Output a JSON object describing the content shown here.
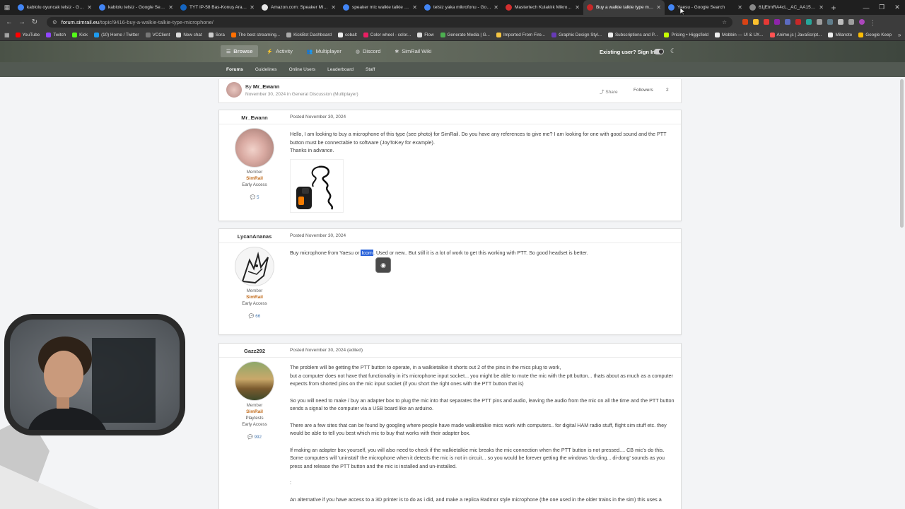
{
  "browser": {
    "tabs": [
      {
        "title": "kablolu oyuncak telsiz - Goog",
        "color": "#4285f4"
      },
      {
        "title": "kablolu telsiz - Google Search",
        "color": "#4285f4"
      },
      {
        "title": "TYT IP-58 Bas-Konuş Araç ve",
        "color": "#1565c0"
      },
      {
        "title": "Amazon.com: Speaker Mic W",
        "color": "#e6e6e6"
      },
      {
        "title": "speaker mic walkie talkie - Go",
        "color": "#4285f4"
      },
      {
        "title": "telsiz yaka mikrofonu - Googl",
        "color": "#4285f4"
      },
      {
        "title": "Mastertech Kulaklık Mikrofon",
        "color": "#d32f2f"
      },
      {
        "title": "Buy a walkie talkie type micro",
        "color": "#c62828"
      },
      {
        "title": "Yaesu - Google Search",
        "color": "#4285f4"
      },
      {
        "title": "61jEtmRA4cL._AC_AA152_.jpg",
        "color": "#888888"
      }
    ],
    "active_tab": 7,
    "new_tab": "+",
    "url_host": "forum.simrail.eu",
    "url_path": "/topic/9416-buy-a-walkie-talkie-type-microphone/",
    "bookmarks": [
      {
        "label": "YouTube",
        "color": "#ff0000"
      },
      {
        "label": "Twitch",
        "color": "#9146ff"
      },
      {
        "label": "Kick",
        "color": "#53fc18"
      },
      {
        "label": "(10) Home / Twitter",
        "color": "#1d9bf0"
      },
      {
        "label": "VCClient",
        "color": "#777777"
      },
      {
        "label": "New chat",
        "color": "#dddddd"
      },
      {
        "label": "Sora",
        "color": "#cccccc"
      },
      {
        "label": "The best streaming...",
        "color": "#ff6f00"
      },
      {
        "label": "KickBot Dashboard",
        "color": "#aaaaaa"
      },
      {
        "label": "cobalt",
        "color": "#eeeeee"
      },
      {
        "label": "Color wheel - color...",
        "color": "#e91e63"
      },
      {
        "label": "Flow",
        "color": "#dddddd"
      },
      {
        "label": "Generate Media | G...",
        "color": "#4caf50"
      },
      {
        "label": "Imported From Fire...",
        "color": "#f5c542"
      },
      {
        "label": "Graphic Design Styl...",
        "color": "#673ab7"
      },
      {
        "label": "Subscriptions and P...",
        "color": "#eeeeee"
      },
      {
        "label": "Pricing • Higgsfield",
        "color": "#c6ff00"
      },
      {
        "label": "Mobbin — UI & UX...",
        "color": "#eeeeee"
      },
      {
        "label": "Anime.js | JavaScript...",
        "color": "#ff5252"
      },
      {
        "label": "Milanote",
        "color": "#eeeeee"
      },
      {
        "label": "Google Keep",
        "color": "#fbbc04"
      }
    ]
  },
  "site": {
    "nav": [
      {
        "label": "Browse",
        "icon": "list-icon",
        "active": true
      },
      {
        "label": "Activity",
        "icon": "activity-icon",
        "active": false
      },
      {
        "label": "Multiplayer",
        "icon": "multiplayer-icon",
        "active": false
      },
      {
        "label": "Discord",
        "icon": "discord-icon",
        "active": false
      },
      {
        "label": "SimRail Wiki",
        "icon": "wiki-icon",
        "active": false
      }
    ],
    "signin": "Existing user? Sign In",
    "subnav": [
      "Forums",
      "Guidelines",
      "Online Users",
      "Leaderboard",
      "Staff"
    ]
  },
  "topic": {
    "by_prefix": "By",
    "author": "Mr_Ewann",
    "date": "November 30, 2024",
    "in_text": "in",
    "category": "General Discussion (Multiplayer)",
    "share": "Share",
    "followers": "Followers",
    "followers_count": "2"
  },
  "posts": [
    {
      "author": "Mr_Ewann",
      "rank": "Member",
      "group": "SimRail",
      "extra": "Early Access",
      "count": "5",
      "date": "Posted November 30, 2024",
      "lines": [
        "Hello, I am looking to buy a microphone of this type (see photo) for SimRail. Do you have any references to give me? I am looking for one with good sound and the PTT button must be connectable to software (JoyToKey for example).",
        "Thanks in advance."
      ]
    },
    {
      "author": "LycanAnanas",
      "rank": "Member",
      "group": "SimRail",
      "extra": "Early Access",
      "count": "66",
      "date": "Posted November 30, 2024",
      "before": "Buy microphone from Yaesu or",
      "highlight": "Icom",
      "after": ". Used or new.. But still it is a lot of work to get this working with PTT. So good headset is better."
    },
    {
      "author": "Gazz292",
      "rank": "Member",
      "group": "SimRail",
      "group2": "Playtests",
      "extra": "Early Access",
      "count": "992",
      "date": "Posted November 30, 2024 (edited)",
      "paras": [
        "The problem will be getting the PTT button to operate,  in a walkietalkie it shorts out 2 of the pins in the mics plug to work,",
        "but a computer does not have that functionality in it's microphone input socket... you might be able to mute the mic with the ptt button... thats about as much as a computer expects from shorted pins on the mic input socket (if you short the right ones with the PTT button that is)",
        "So you will need to make / buy an adapter box to plug the mic into that separates the PTT pins and audio, leaving the audio from the mic on all the time and the PTT button sends a signal to the computer via a USB board like an arduino.",
        "There are a few sites that can be found by googling where people have made walkietalkie mics work with computers.. for digital HAM radio stuff, flight sim stuff etc. they would be able to tell you best which mic to buy that works with their adapter box.",
        "If making an adapter box yourself, you will also need to check if the walkietalkie mic breaks the mic connection when the PTT button is not pressed.... CB mic's do this. Some computers will 'uninstall' the microphone when it detects the mic is not in circuit... so you would be forever getting the windows 'du-ding... di-dong' sounds as you press and release the PTT button and the mic is installed and un-installed.",
        ":",
        "An alternative if you have access to a 3D printer is to do as i did, and make a replica Radmor style microphone (the one used in the older trains in the sim)  this uses a"
      ]
    }
  ]
}
